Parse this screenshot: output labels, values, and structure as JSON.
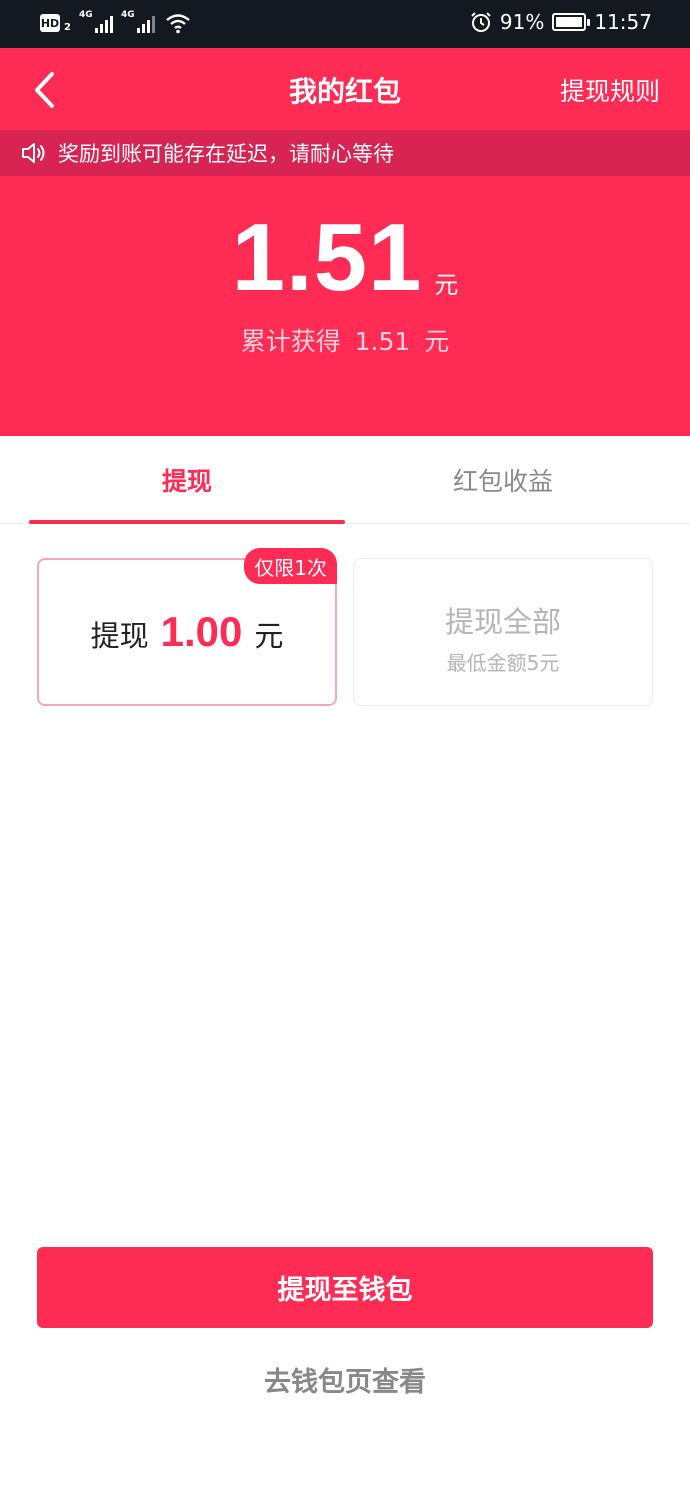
{
  "status_bar": {
    "hd_label": "HD",
    "hd_sub": "2",
    "network1": "4G",
    "network2": "4G",
    "battery_percent": "91%",
    "time": "11:57"
  },
  "header": {
    "title": "我的红包",
    "rules_label": "提现规则"
  },
  "notice": {
    "text": "奖励到账可能存在延迟，请耐心等待"
  },
  "balance": {
    "amount": "1.51",
    "unit": "元",
    "total_prefix": "累计获得",
    "total_value": "1.51",
    "total_unit": "元"
  },
  "tabs": [
    {
      "label": "提现",
      "active": true
    },
    {
      "label": "红包收益",
      "active": false
    }
  ],
  "options": {
    "one": {
      "prefix": "提现",
      "value": "1.00",
      "unit": "元",
      "badge": "仅限1次"
    },
    "all": {
      "title": "提现全部",
      "subtitle": "最低金额5元"
    }
  },
  "actions": {
    "primary_label": "提现至钱包",
    "secondary_label": "去钱包页查看"
  },
  "colors": {
    "brand": "#fe2c55",
    "notice_bg": "#d72453",
    "status_bar": "#141821"
  }
}
